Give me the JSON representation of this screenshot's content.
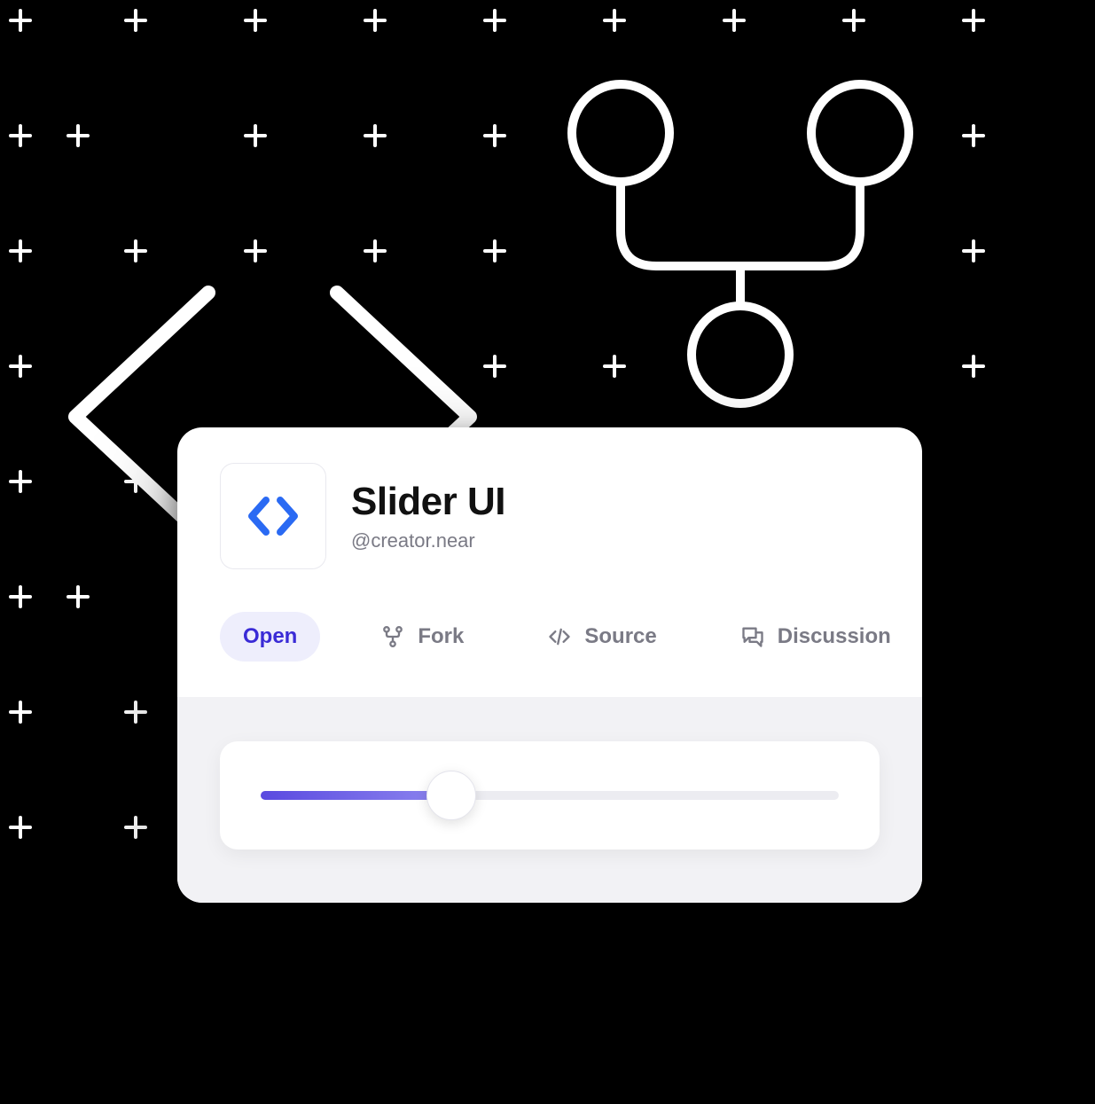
{
  "component": {
    "title": "Slider UI",
    "creator": "@creator.near"
  },
  "tabs": {
    "open": {
      "label": "Open"
    },
    "fork": {
      "label": "Fork"
    },
    "source": {
      "label": "Source"
    },
    "discussion": {
      "label": "Discussion"
    }
  },
  "slider": {
    "value_percent": 33
  },
  "colors": {
    "accent": "#3a2bd6",
    "accent_bg": "#eeeefc",
    "icon_blue": "#2a6af3",
    "slider_from": "#5a4ae0",
    "slider_to": "#8e86ef"
  }
}
